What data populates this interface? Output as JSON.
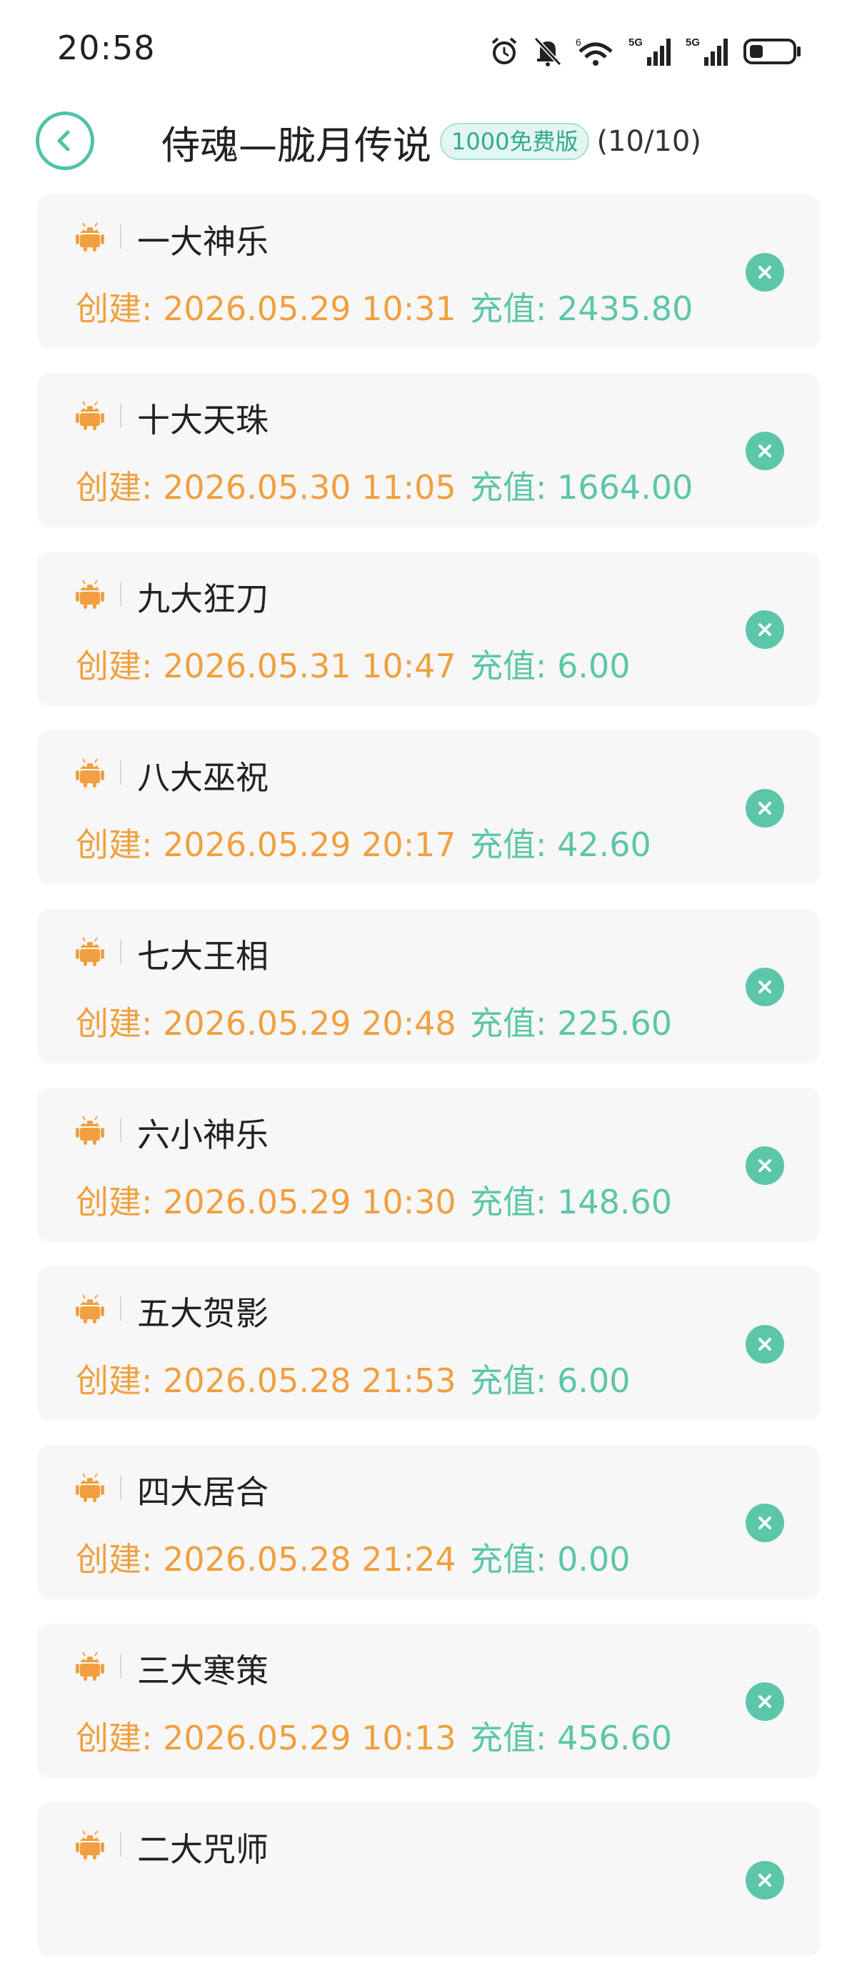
{
  "status_bar": {
    "time": "20:58",
    "network1": "5G",
    "network2": "5G",
    "wifi_badge": "6"
  },
  "header": {
    "title": "侍魂—胧月传说",
    "badge": "1000免费版",
    "count": "(10/10)"
  },
  "labels": {
    "created_prefix": "创建: ",
    "recharge_prefix": "充值: "
  },
  "colors": {
    "accent": "#4fc3a6",
    "created": "#f0a040",
    "recharge": "#5cc6a8",
    "card_bg": "#f7f7f7"
  },
  "accounts": [
    {
      "name": "一大神乐",
      "created": "创建: 2026.05.29 10:31",
      "recharge": "充值: 2435.80"
    },
    {
      "name": "十大天珠",
      "created": "创建: 2026.05.30 11:05",
      "recharge": "充值: 1664.00"
    },
    {
      "name": "九大狂刀",
      "created": "创建: 2026.05.31 10:47",
      "recharge": "充值: 6.00"
    },
    {
      "name": "八大巫祝",
      "created": "创建: 2026.05.29 20:17",
      "recharge": "充值: 42.60"
    },
    {
      "name": "七大王相",
      "created": "创建: 2026.05.29 20:48",
      "recharge": "充值: 225.60"
    },
    {
      "name": "六小神乐",
      "created": "创建: 2026.05.29 10:30",
      "recharge": "充值: 148.60"
    },
    {
      "name": "五大贺影",
      "created": "创建: 2026.05.28 21:53",
      "recharge": "充值: 6.00"
    },
    {
      "name": "四大居合",
      "created": "创建: 2026.05.28 21:24",
      "recharge": "充值: 0.00"
    },
    {
      "name": "三大寒策",
      "created": "创建: 2026.05.29 10:13",
      "recharge": "充值: 456.60"
    },
    {
      "name": "二大咒师",
      "created": "",
      "recharge": ""
    }
  ]
}
